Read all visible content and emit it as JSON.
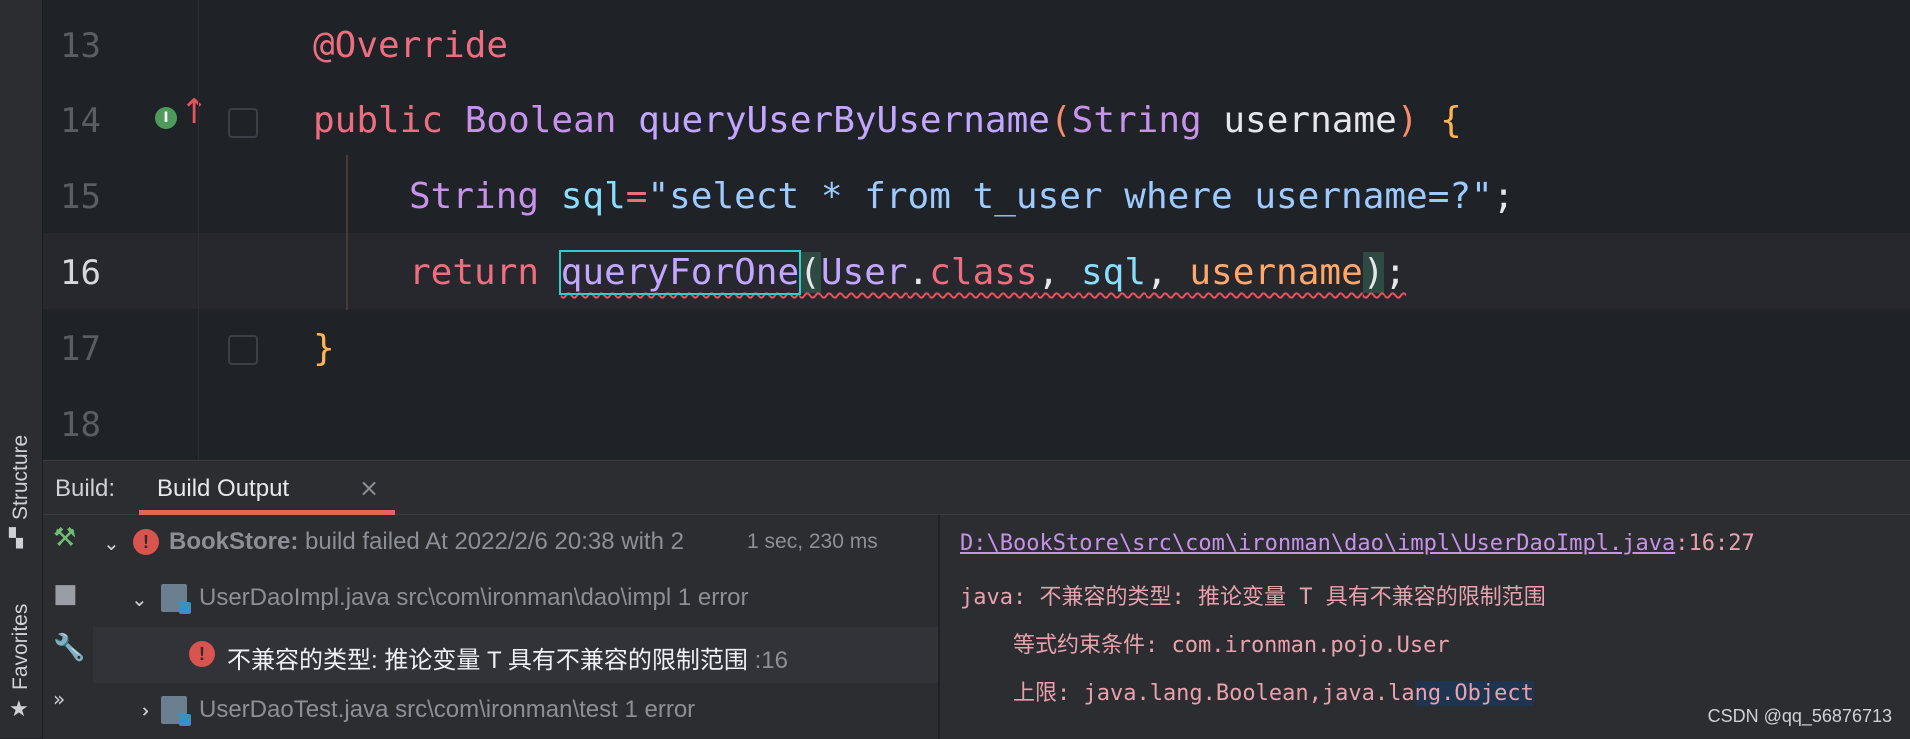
{
  "editor": {
    "lines": [
      {
        "num": "13"
      },
      {
        "num": "14"
      },
      {
        "num": "15"
      },
      {
        "num": "16"
      },
      {
        "num": "17"
      },
      {
        "num": "18"
      }
    ],
    "code": {
      "l13": "@Override",
      "l14": {
        "kw": "public",
        "type": "Boolean",
        "fn": "queryUserByUsername",
        "p_open": "(",
        "ptype": "String",
        "pname": "username",
        "p_close": ")",
        "brace": "{"
      },
      "l15": {
        "type": "String",
        "var": "sql",
        "eq": "=",
        "str": "\"select * from t_user where username=?\"",
        "semi": ";"
      },
      "l16": {
        "kw": "return",
        "fn": "queryForOne",
        "p_open": "(",
        "cls": "User",
        "dot": ".",
        "classkw": "class",
        "comma1": ", ",
        "arg1": "sql",
        "comma2": ", ",
        "arg2": "username",
        "p_close": ")",
        "semi": ";"
      },
      "l17": "}"
    },
    "gutter_icons": {
      "impl": "I"
    }
  },
  "left_strip": {
    "structure": "Structure",
    "favorites": "Favorites",
    "more": "»"
  },
  "build": {
    "label": "Build:",
    "tab": "Build Output",
    "tab_close": "×",
    "tree": [
      {
        "name": "BookStore:",
        "desc": "build failed At 2022/2/6 20:38 with 2",
        "time": "1 sec, 230 ms"
      },
      {
        "name": "UserDaoImpl.java",
        "desc": "src\\com\\ironman\\dao\\impl 1 error"
      },
      {
        "name": "不兼容的类型: 推论变量 T 具有不兼容的限制范围",
        "desc": ":16"
      },
      {
        "name": "UserDaoTest.java",
        "desc": "src\\com\\ironman\\test 1 error"
      }
    ],
    "console": {
      "path": "D:\\BookStore\\src\\com\\ironman\\dao\\impl\\UserDaoImpl.java",
      "pos": ":16:27",
      "l2": "java: 不兼容的类型: 推论变量 T 具有不兼容的限制范围",
      "l3": "    等式约束条件: com.ironman.pojo.User",
      "l4a": "    上限: java.lang.Boolean,java.la",
      "l4b": "ng.Object"
    }
  },
  "watermark": "CSDN @qq_56876713"
}
